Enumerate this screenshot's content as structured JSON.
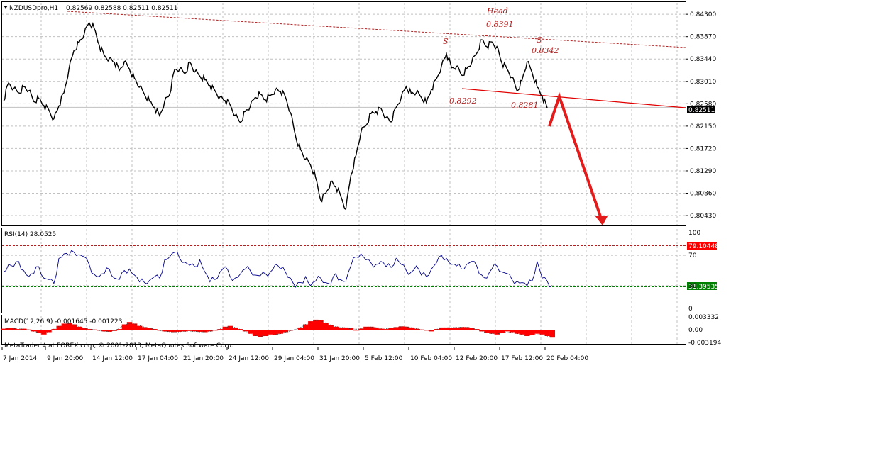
{
  "header": {
    "symbol_label": "NZDUSDpro,H1",
    "ohlc": "0.82569 0.82588 0.82511 0.82511"
  },
  "indicators": {
    "rsi_label": "RSI(14) 28.0525",
    "macd_label": "MACD(12,26,9) -0.001645 -0.001223"
  },
  "watermark": "MetaTrader 4 at FOREX.com, © 2001-2013, MetaQuotes Software Corp.",
  "colors": {
    "price": "#000000",
    "rsi": "#00008b",
    "macd": "#ff0000",
    "annotation": "#b22222",
    "grid": "#c0c0c0",
    "current_price_bg": "#000000",
    "rsi_upper_bg": "#ff0000",
    "rsi_lower_bg": "#008000"
  },
  "chart_data": [
    {
      "type": "line",
      "panel": "price",
      "ylim": [
        0.8024,
        0.8452
      ],
      "y_ticks": [
        "0.84300",
        "0.83870",
        "0.83440",
        "0.83010",
        "0.82580",
        "0.82150",
        "0.81720",
        "0.81290",
        "0.80860",
        "0.80430"
      ],
      "current_price": "0.82511",
      "series": [
        {
          "values": [
            0.8263,
            0.8298,
            0.8287,
            0.8279,
            0.8291,
            0.8283,
            0.8262,
            0.8268,
            0.8255,
            0.8246,
            0.8229,
            0.8254,
            0.8279,
            0.8325,
            0.8361,
            0.8376,
            0.8391,
            0.8414,
            0.8403,
            0.8371,
            0.8351,
            0.8345,
            0.8338,
            0.8322,
            0.8339,
            0.8325,
            0.8307,
            0.829,
            0.8276,
            0.8263,
            0.8251,
            0.8235,
            0.8263,
            0.8276,
            0.8324,
            0.8325,
            0.8316,
            0.8338,
            0.8319,
            0.8311,
            0.8304,
            0.8293,
            0.8283,
            0.8271,
            0.8264,
            0.8256,
            0.8236,
            0.8222,
            0.8243,
            0.8252,
            0.827,
            0.8276,
            0.8266,
            0.8274,
            0.8285,
            0.8282,
            0.8271,
            0.8241,
            0.8196,
            0.817,
            0.8151,
            0.814,
            0.8116,
            0.8073,
            0.8086,
            0.8108,
            0.8098,
            0.808,
            0.8055,
            0.812,
            0.8158,
            0.8203,
            0.8216,
            0.8239,
            0.8243,
            0.8249,
            0.8232,
            0.8223,
            0.8251,
            0.827,
            0.8291,
            0.8278,
            0.8279,
            0.827,
            0.826,
            0.8286,
            0.8306,
            0.8331,
            0.8354,
            0.8327,
            0.833,
            0.8313,
            0.8325,
            0.8337,
            0.8355,
            0.8381,
            0.8368,
            0.8377,
            0.8368,
            0.8336,
            0.8325,
            0.8309,
            0.8283,
            0.8303,
            0.8338,
            0.8318,
            0.829,
            0.8273,
            0.825
          ]
        }
      ]
    },
    {
      "type": "line",
      "panel": "rsi",
      "ylim": [
        0,
        100
      ],
      "y_ticks": [
        "100",
        "70",
        "30",
        "0"
      ],
      "levels": [
        "79.10448",
        "31.39535"
      ],
      "series": [
        {
          "values": [
            48,
            58,
            55,
            62,
            50,
            42,
            46,
            55,
            40,
            38,
            33,
            66,
            72,
            70,
            74,
            71,
            68,
            58,
            45,
            42,
            46,
            52,
            40,
            38,
            50,
            52,
            44,
            35,
            34,
            37,
            42,
            40,
            64,
            68,
            74,
            66,
            61,
            57,
            55,
            64,
            48,
            35,
            38,
            48,
            55,
            42,
            40,
            45,
            52,
            50,
            44,
            43,
            46,
            48,
            58,
            52,
            48,
            40,
            28,
            34,
            42,
            30,
            36,
            40,
            34,
            32,
            46,
            38,
            36,
            56,
            68,
            72,
            64,
            60,
            58,
            62,
            55,
            54,
            66,
            58,
            50,
            48,
            56,
            44,
            42,
            52,
            60,
            70,
            66,
            58,
            56,
            52,
            58,
            62,
            56,
            44,
            40,
            52,
            56,
            48,
            46,
            38,
            36,
            34,
            30,
            36,
            62,
            40,
            36,
            30
          ]
        }
      ]
    },
    {
      "type": "bar",
      "panel": "macd",
      "ylim": [
        -0.0036,
        0.0035
      ],
      "y_ticks": [
        "0.003332",
        "0.00",
        "-0.003194"
      ],
      "series": [
        {
          "values": [
            0.0003,
            0.0005,
            0.0004,
            0.0002,
            0.0003,
            0.0001,
            -0.0004,
            -0.0008,
            -0.0012,
            -0.0006,
            0.0002,
            0.001,
            0.0016,
            0.0018,
            0.0014,
            0.0008,
            0.0004,
            0.0002,
            0.0001,
            -0.0002,
            -0.0004,
            -0.0005,
            -0.0003,
            0.0002,
            0.0014,
            0.002,
            0.0016,
            0.001,
            0.0007,
            0.0004,
            0.0002,
            -0.0002,
            -0.0004,
            -0.0005,
            -0.0006,
            -0.0005,
            -0.0004,
            -0.0003,
            -0.0004,
            -0.0005,
            -0.0006,
            -0.0004,
            -0.0002,
            0.0002,
            0.0008,
            0.001,
            0.0006,
            0.0002,
            -0.0004,
            -0.001,
            -0.0016,
            -0.0018,
            -0.0016,
            -0.0012,
            -0.0014,
            -0.001,
            -0.0006,
            -0.0002,
            0.0,
            0.0006,
            0.0014,
            0.0022,
            0.0026,
            0.0024,
            0.0018,
            0.0012,
            0.0008,
            0.0006,
            0.0006,
            0.0004,
            -0.0002,
            0.0003,
            0.0008,
            0.0008,
            0.0006,
            0.0003,
            0.0002,
            0.0004,
            0.0007,
            0.0009,
            0.0008,
            0.0006,
            0.0003,
            0.0001,
            -0.0002,
            -0.0004,
            0.0002,
            0.0006,
            0.0006,
            0.0005,
            0.0006,
            0.0007,
            0.0007,
            0.0005,
            0.0002,
            -0.0004,
            -0.0008,
            -0.001,
            -0.0012,
            -0.0008,
            -0.0004,
            -0.0006,
            -0.001,
            -0.0012,
            -0.0016,
            -0.0014,
            -0.001,
            -0.0012,
            -0.0016,
            -0.002
          ]
        }
      ]
    }
  ],
  "time_axis": [
    "7 Jan 2014",
    "9 Jan 20:00",
    "14 Jan 12:00",
    "17 Jan 04:00",
    "21 Jan 20:00",
    "24 Jan 12:00",
    "29 Jan 04:00",
    "31 Jan 20:00",
    "5 Feb 12:00",
    "10 Feb 04:00",
    "12 Feb 20:00",
    "17 Feb 12:00",
    "20 Feb 04:00"
  ],
  "annotations": {
    "head_label": "Head",
    "head_value": "0.8391",
    "left_shoulder": "S",
    "right_shoulder": "S",
    "right_shoulder_value": "0.8342",
    "neck_left_value": "0.8292",
    "neck_right_value": "0.8281"
  }
}
